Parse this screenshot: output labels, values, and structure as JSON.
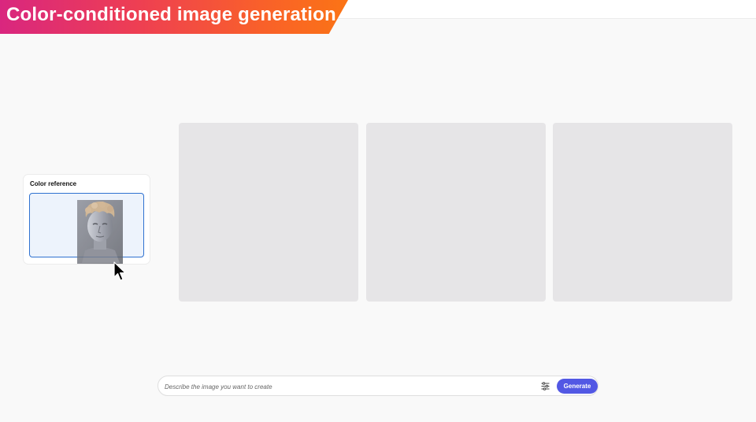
{
  "banner": {
    "title": "Color-conditioned image generation"
  },
  "color_reference": {
    "title": "Color reference",
    "image": "statue-head-photo"
  },
  "results": {
    "tiles": [
      "empty",
      "empty",
      "empty"
    ]
  },
  "prompt": {
    "placeholder": "Describe the image you want to create",
    "value": "",
    "generate_label": "Generate",
    "settings_icon": "sliders-icon"
  },
  "colors": {
    "banner_start": "#d9267f",
    "banner_end": "#fb7415",
    "accent": "#5258e4",
    "dropzone_border": "#2f72d0",
    "dropzone_fill": "#edf3fc",
    "tile_fill": "#e6e5e7"
  }
}
